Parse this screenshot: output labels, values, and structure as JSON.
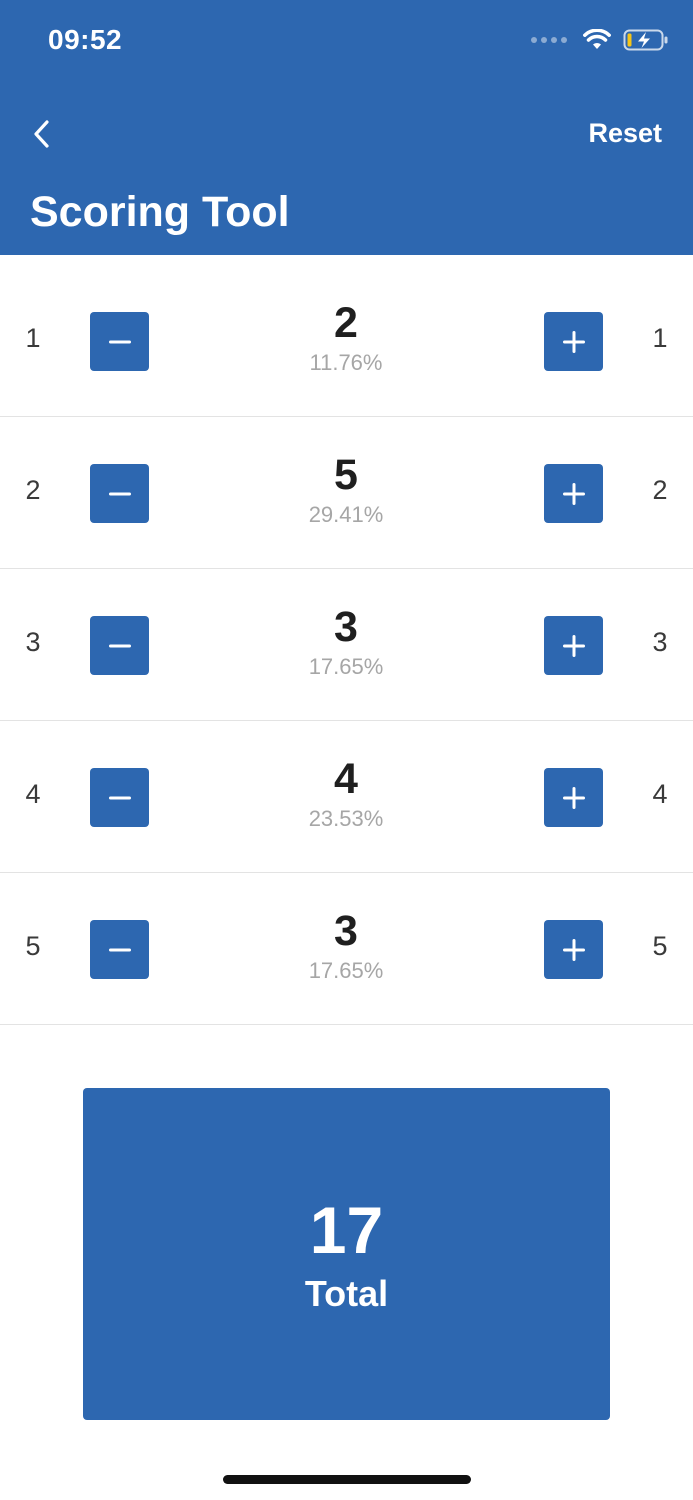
{
  "status_bar": {
    "time": "09:52",
    "icons": [
      "signal-icon",
      "wifi-icon",
      "battery-charging-icon"
    ]
  },
  "nav": {
    "back_icon": "chevron-left-icon",
    "reset_label": "Reset",
    "title": "Scoring Tool"
  },
  "rows": [
    {
      "left_label": "1",
      "count": "2",
      "percent": "11.76%",
      "right_label": "1"
    },
    {
      "left_label": "2",
      "count": "5",
      "percent": "29.41%",
      "right_label": "2"
    },
    {
      "left_label": "3",
      "count": "3",
      "percent": "17.65%",
      "right_label": "3"
    },
    {
      "left_label": "4",
      "count": "4",
      "percent": "23.53%",
      "right_label": "4"
    },
    {
      "left_label": "5",
      "count": "3",
      "percent": "17.65%",
      "right_label": "5"
    }
  ],
  "total": {
    "value": "17",
    "label": "Total"
  },
  "colors": {
    "primary": "#2d67b0",
    "text": "#1f1f1f",
    "muted": "#a6a6a6",
    "divider": "#e3e3e3",
    "battery_charge": "#f5c518"
  }
}
